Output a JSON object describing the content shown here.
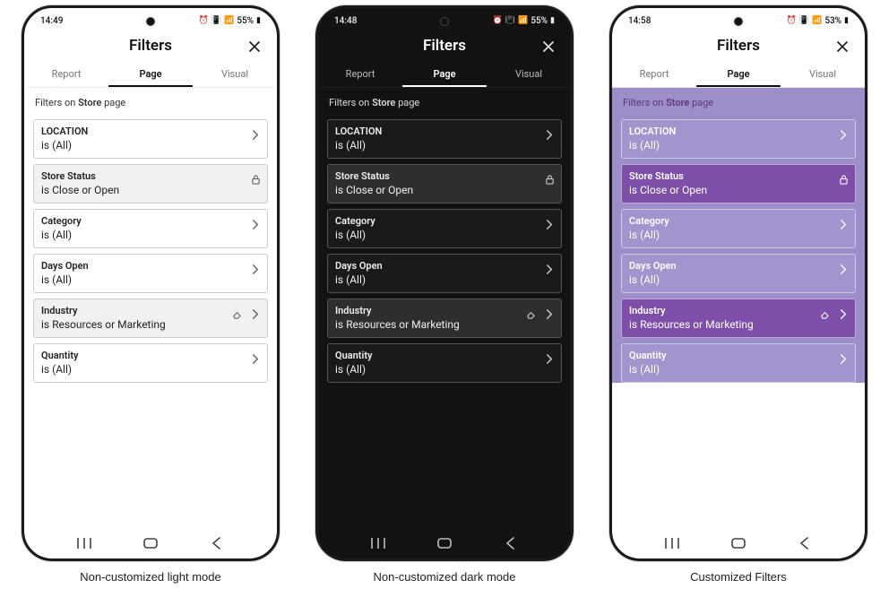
{
  "phones": [
    {
      "mode": "light",
      "time": "14:49",
      "battery": "55%",
      "title": "Filters",
      "caption": "Non-customized light mode"
    },
    {
      "mode": "dark",
      "time": "14:48",
      "battery": "55%",
      "title": "Filters",
      "caption": "Non-customized dark mode"
    },
    {
      "mode": "purple",
      "time": "14:58",
      "battery": "53%",
      "title": "Filters",
      "caption": "Customized Filters"
    }
  ],
  "tabs": [
    "Report",
    "Page",
    "Visual"
  ],
  "active_tab": "Page",
  "section_label_prefix": "Filters on ",
  "section_label_bold": "Store",
  "section_label_suffix": " page",
  "filters": [
    {
      "title": "LOCATION",
      "value": "is (All)",
      "applied": false,
      "locked": false,
      "erasable": false
    },
    {
      "title": "Store Status",
      "value": "is Close or Open",
      "applied": true,
      "locked": true,
      "erasable": false
    },
    {
      "title": "Category",
      "value": "is (All)",
      "applied": false,
      "locked": false,
      "erasable": false
    },
    {
      "title": "Days Open",
      "value": "is (All)",
      "applied": false,
      "locked": false,
      "erasable": false
    },
    {
      "title": "Industry",
      "value": "is Resources or Marketing",
      "applied": true,
      "locked": false,
      "erasable": true
    },
    {
      "title": "Quantity",
      "value": "is (All)",
      "applied": false,
      "locked": false,
      "erasable": false
    }
  ],
  "icons": {
    "chevron": "chevron-right-icon",
    "lock": "lock-icon",
    "eraser": "eraser-icon",
    "close": "close-icon",
    "recents": "recents-icon",
    "home": "home-icon",
    "back": "back-icon"
  },
  "colors": {
    "purple_bg": "#9d8dc8",
    "purple_applied": "#7d4fa8",
    "dark_bg": "#121212",
    "dark_applied": "#2e2e2e"
  }
}
